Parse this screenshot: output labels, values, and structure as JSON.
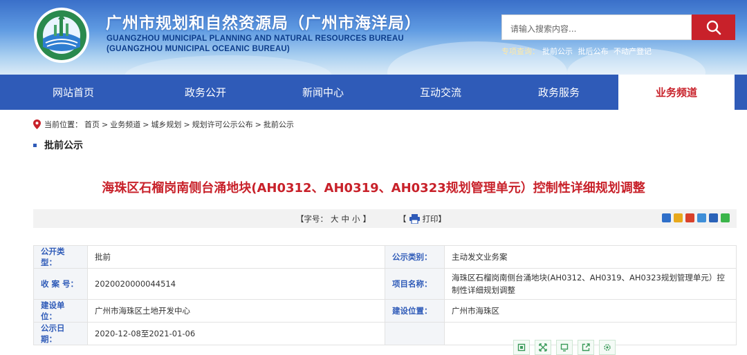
{
  "header": {
    "title_cn": "广州市规划和自然资源局（广州市海洋局）",
    "title_en_line1": "GUANGZHOU MUNICIPAL PLANNING AND NATURAL RESOURCES BUREAU",
    "title_en_line2": "(GUANGZHOU MUNICIPAL OCEANIC BUREAU)",
    "logo_text": "广州市规划和自然资源局",
    "search_placeholder": "请输入搜索内容...",
    "quick_links_title": "专项查询：",
    "quick_links": [
      "批前公示",
      "批后公布",
      "不动产登记"
    ]
  },
  "nav": {
    "items": [
      {
        "label": "网站首页",
        "active": false
      },
      {
        "label": "政务公开",
        "active": false
      },
      {
        "label": "新闻中心",
        "active": false
      },
      {
        "label": "互动交流",
        "active": false
      },
      {
        "label": "政务服务",
        "active": false
      },
      {
        "label": "业务频道",
        "active": true
      }
    ]
  },
  "breadcrumb": {
    "prefix": "当前位置：",
    "items": [
      "首页",
      "业务频道",
      "城乡规划",
      "规划许可公示公布",
      "批前公示"
    ],
    "separator": ">"
  },
  "section_title": "批前公示",
  "doc_title": "海珠区石榴岗南侧台涌地块(AH0312、AH0319、AH0323规划管理单元）控制性详细规划调整",
  "toolbar": {
    "fontsize_label": "【字号：",
    "size_large": "大",
    "size_medium": "中",
    "size_small": "小",
    "fontsize_end": "】",
    "print_open": "【",
    "print_label": "打印",
    "print_close": "】"
  },
  "info": {
    "row1": {
      "k1": "公开类型：",
      "v1": "批前",
      "k2": "公示类别：",
      "v2": "主动发文业务案"
    },
    "row2": {
      "k1": "收 案 号：",
      "v1": "2020020000044514",
      "k2": "项目名称：",
      "v2": "海珠区石榴岗南侧台涌地块(AH0312、AH0319、AH0323规划管理单元）控制性详细规划调整"
    },
    "row3": {
      "k1": "建设单位：",
      "v1": "广州市海珠区土地开发中心",
      "k2": "建设位置：",
      "v2": "广州市海珠区"
    },
    "row4": {
      "k1": "公示日期：",
      "v1": "2020-12-08至2021-01-06"
    }
  },
  "colors": {
    "brand_blue": "#2f5bb8",
    "accent_red": "#c8212a"
  }
}
